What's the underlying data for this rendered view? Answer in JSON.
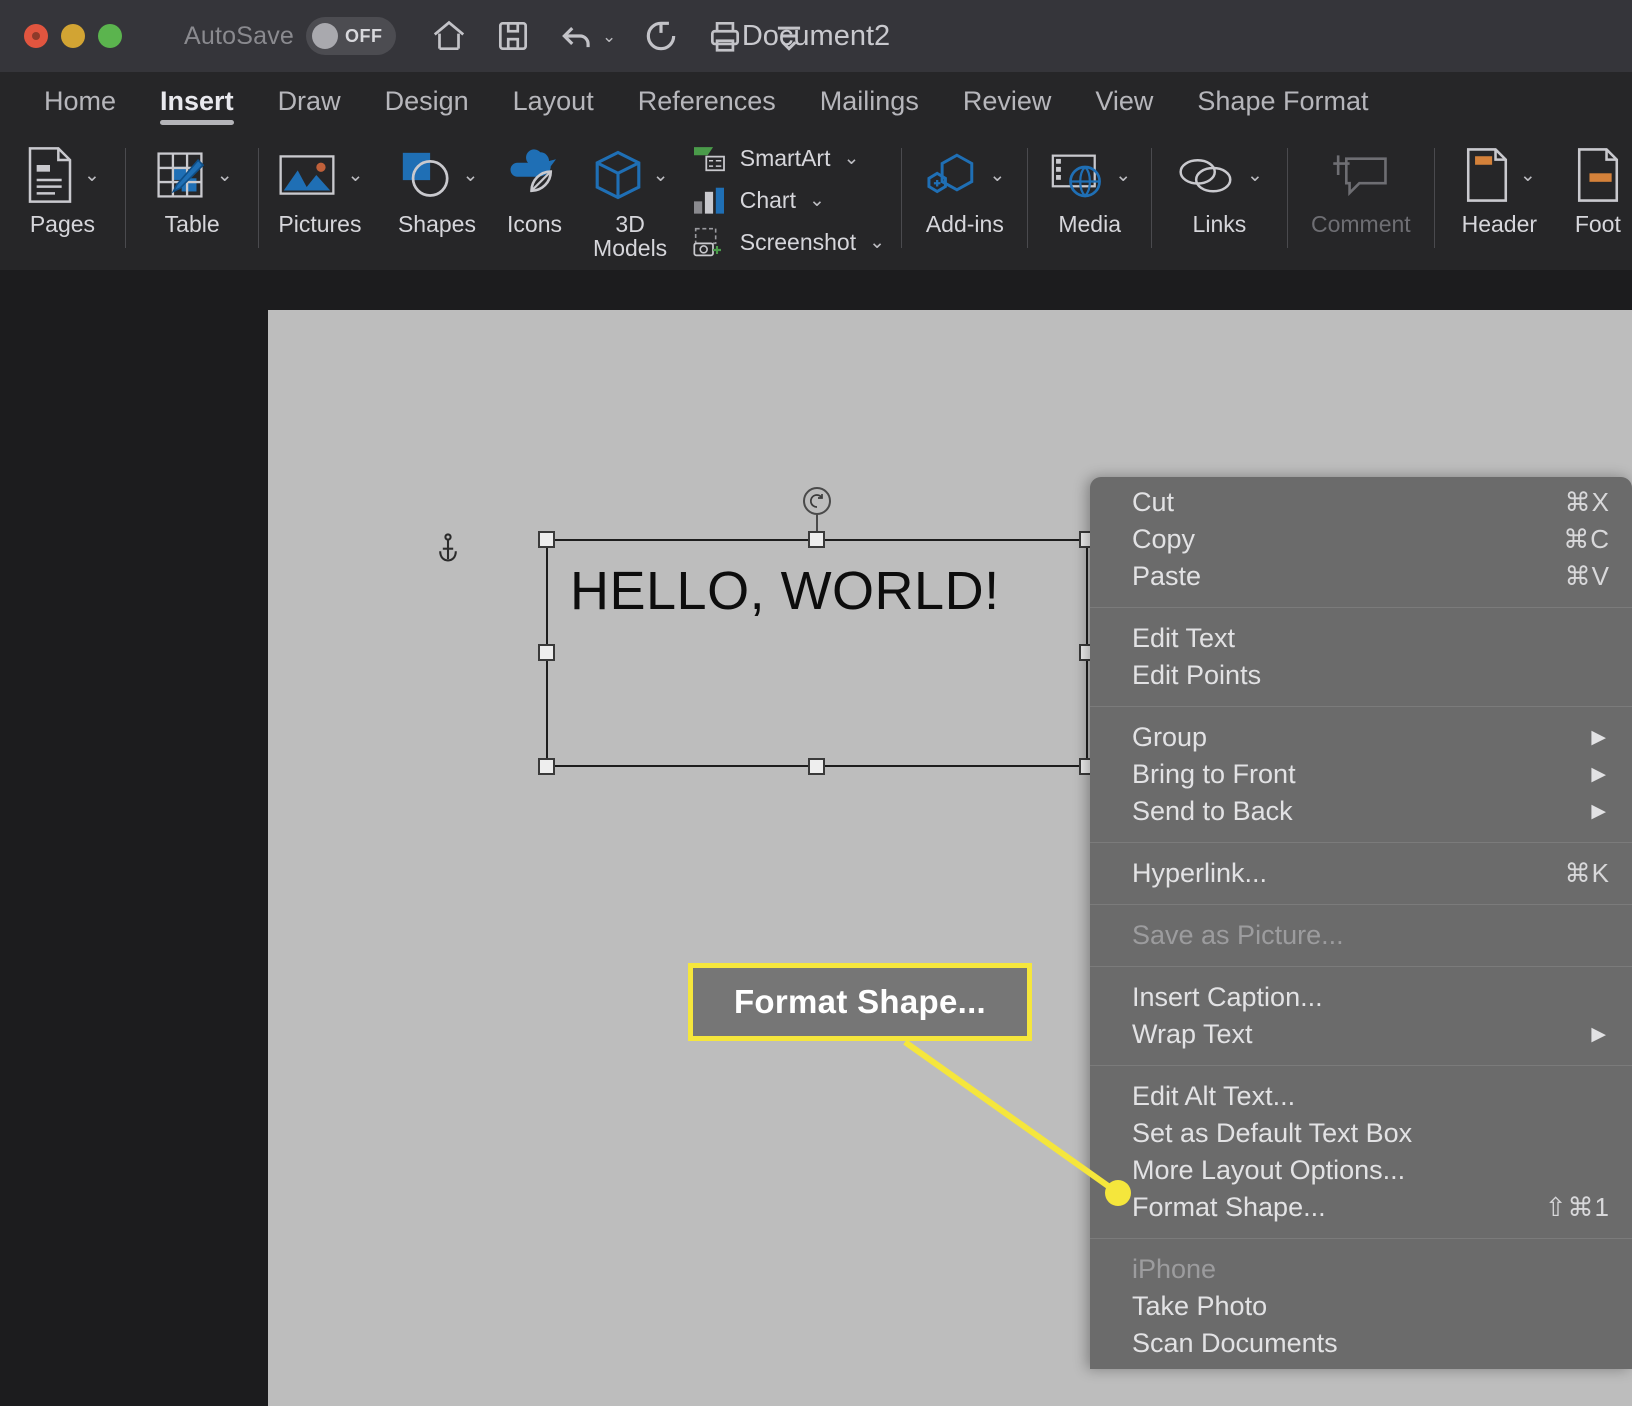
{
  "window": {
    "title": "Document2",
    "traffic_lights": [
      "close-button",
      "minimize-button",
      "maximize-button"
    ],
    "autosave": {
      "label": "AutoSave",
      "state": "OFF"
    },
    "quick_access": [
      "home-icon",
      "save-icon",
      "undo-icon",
      "redo-icon",
      "print-icon",
      "customize-toolbar-icon"
    ]
  },
  "tabs": [
    {
      "label": "Home",
      "active": false
    },
    {
      "label": "Insert",
      "active": true
    },
    {
      "label": "Draw",
      "active": false
    },
    {
      "label": "Design",
      "active": false
    },
    {
      "label": "Layout",
      "active": false
    },
    {
      "label": "References",
      "active": false
    },
    {
      "label": "Mailings",
      "active": false
    },
    {
      "label": "Review",
      "active": false
    },
    {
      "label": "View",
      "active": false
    },
    {
      "label": "Shape Format",
      "active": false
    }
  ],
  "ribbon": {
    "buttons": [
      {
        "label": "Pages",
        "icon": "pages-icon",
        "dropdown": true,
        "disabled": false
      },
      {
        "label": "Table",
        "icon": "table-icon",
        "dropdown": true,
        "disabled": false
      },
      {
        "label": "Pictures",
        "icon": "pictures-icon",
        "dropdown": true,
        "disabled": false
      },
      {
        "label": "Shapes",
        "icon": "shapes-icon",
        "dropdown": true,
        "disabled": false
      },
      {
        "label": "Icons",
        "icon": "icons-icon",
        "dropdown": false,
        "disabled": false
      },
      {
        "label": "3D Models",
        "icon": "3d-models-icon",
        "dropdown": true,
        "disabled": false
      },
      {
        "label": "Add-ins",
        "icon": "add-ins-icon",
        "dropdown": true,
        "disabled": false
      },
      {
        "label": "Media",
        "icon": "media-icon",
        "dropdown": true,
        "disabled": false
      },
      {
        "label": "Links",
        "icon": "links-icon",
        "dropdown": true,
        "disabled": false
      },
      {
        "label": "Comment",
        "icon": "comment-icon",
        "dropdown": false,
        "disabled": true
      },
      {
        "label": "Header",
        "icon": "header-icon",
        "dropdown": true,
        "disabled": false
      },
      {
        "label": "Foot",
        "icon": "footer-icon",
        "dropdown": false,
        "disabled": false
      }
    ],
    "stack": [
      {
        "label": "SmartArt",
        "icon": "smartart-icon",
        "dropdown": true
      },
      {
        "label": "Chart",
        "icon": "chart-icon",
        "dropdown": true
      },
      {
        "label": "Screenshot",
        "icon": "screenshot-icon",
        "dropdown": true
      }
    ]
  },
  "canvas": {
    "textbox_text": "HELLO, WORLD!",
    "anchor_icon": "anchor-icon",
    "rotate_icon": "rotate-handle-icon"
  },
  "callout": {
    "label": "Format Shape...",
    "border_color": "#f5e63c",
    "fill_color": "#767676"
  },
  "context_menu": {
    "groups": [
      {
        "items": [
          {
            "label": "Cut",
            "shortcut": "⌘X",
            "disabled": false,
            "submenu": false
          },
          {
            "label": "Copy",
            "shortcut": "⌘C",
            "disabled": false,
            "submenu": false
          },
          {
            "label": "Paste",
            "shortcut": "⌘V",
            "disabled": false,
            "submenu": false
          }
        ]
      },
      {
        "items": [
          {
            "label": "Edit Text",
            "shortcut": "",
            "disabled": false,
            "submenu": false
          },
          {
            "label": "Edit Points",
            "shortcut": "",
            "disabled": false,
            "submenu": false
          }
        ]
      },
      {
        "items": [
          {
            "label": "Group",
            "shortcut": "",
            "disabled": false,
            "submenu": true
          },
          {
            "label": "Bring to Front",
            "shortcut": "",
            "disabled": false,
            "submenu": true
          },
          {
            "label": "Send to Back",
            "shortcut": "",
            "disabled": false,
            "submenu": true
          }
        ]
      },
      {
        "items": [
          {
            "label": "Hyperlink...",
            "shortcut": "⌘K",
            "disabled": false,
            "submenu": false
          }
        ]
      },
      {
        "items": [
          {
            "label": "Save as Picture...",
            "shortcut": "",
            "disabled": true,
            "submenu": false
          }
        ]
      },
      {
        "items": [
          {
            "label": "Insert Caption...",
            "shortcut": "",
            "disabled": false,
            "submenu": false
          },
          {
            "label": "Wrap Text",
            "shortcut": "",
            "disabled": false,
            "submenu": true
          }
        ]
      },
      {
        "items": [
          {
            "label": "Edit Alt Text...",
            "shortcut": "",
            "disabled": false,
            "submenu": false
          },
          {
            "label": "Set as Default Text Box",
            "shortcut": "",
            "disabled": false,
            "submenu": false
          },
          {
            "label": "More Layout Options...",
            "shortcut": "",
            "disabled": false,
            "submenu": false
          },
          {
            "label": "Format Shape...",
            "shortcut": "⇧⌘1",
            "disabled": false,
            "submenu": false
          }
        ]
      },
      {
        "items": [
          {
            "label": "iPhone",
            "shortcut": "",
            "disabled": true,
            "submenu": false
          },
          {
            "label": "Take Photo",
            "shortcut": "",
            "disabled": false,
            "submenu": false
          },
          {
            "label": "Scan Documents",
            "shortcut": "",
            "disabled": false,
            "submenu": false
          }
        ]
      }
    ]
  }
}
